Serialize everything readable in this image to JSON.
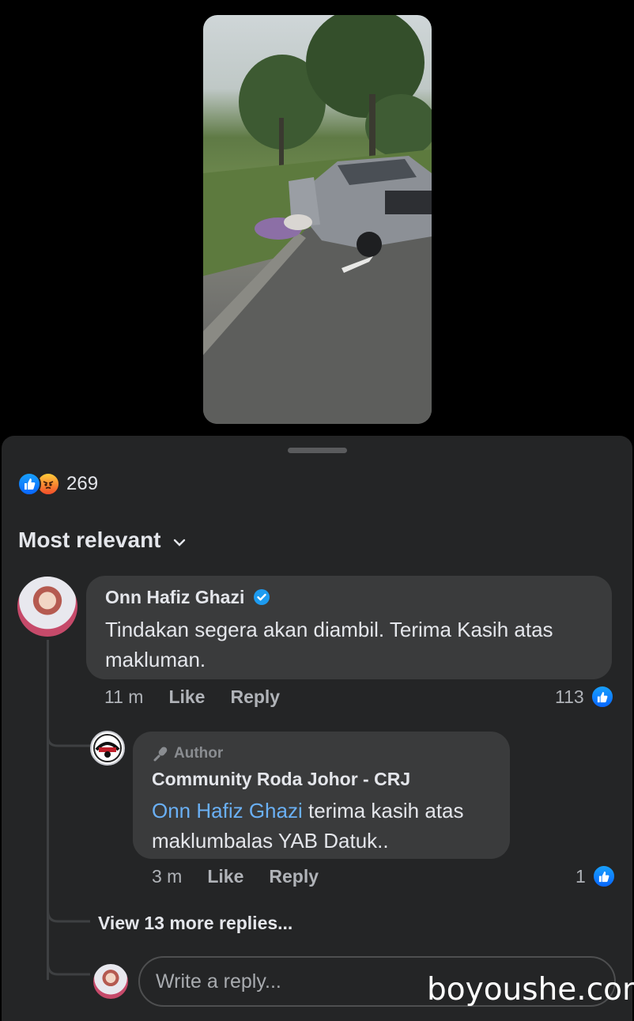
{
  "video": {
    "description_icon": "video-thumbnail"
  },
  "reactions": {
    "icons": [
      "like-icon",
      "angry-icon"
    ],
    "count": "269"
  },
  "sort": {
    "label": "Most relevant"
  },
  "comments": [
    {
      "author": "Onn Hafiz Ghazi",
      "verified": true,
      "text": "Tindakan segera akan diambil. Terima Kasih atas makluman.",
      "time": "11 m",
      "like_label": "Like",
      "reply_label": "Reply",
      "like_count": "113"
    }
  ],
  "replies": [
    {
      "badge": "Author",
      "author": "Community Roda Johor - CRJ",
      "mention": "Onn Hafiz Ghazi",
      "text": " terima kasih atas maklumbalas YAB Datuk..",
      "time": "3 m",
      "like_label": "Like",
      "reply_label": "Reply",
      "like_count": "1"
    }
  ],
  "view_more": "View 13 more replies...",
  "reply_input": {
    "placeholder": "Write a reply..."
  },
  "watermark": "boyoushe.com",
  "colors": {
    "like_blue": "#0866ff",
    "link": "#6ab0f5",
    "sheet_bg": "#242526",
    "bubble_bg": "#3a3b3c"
  }
}
